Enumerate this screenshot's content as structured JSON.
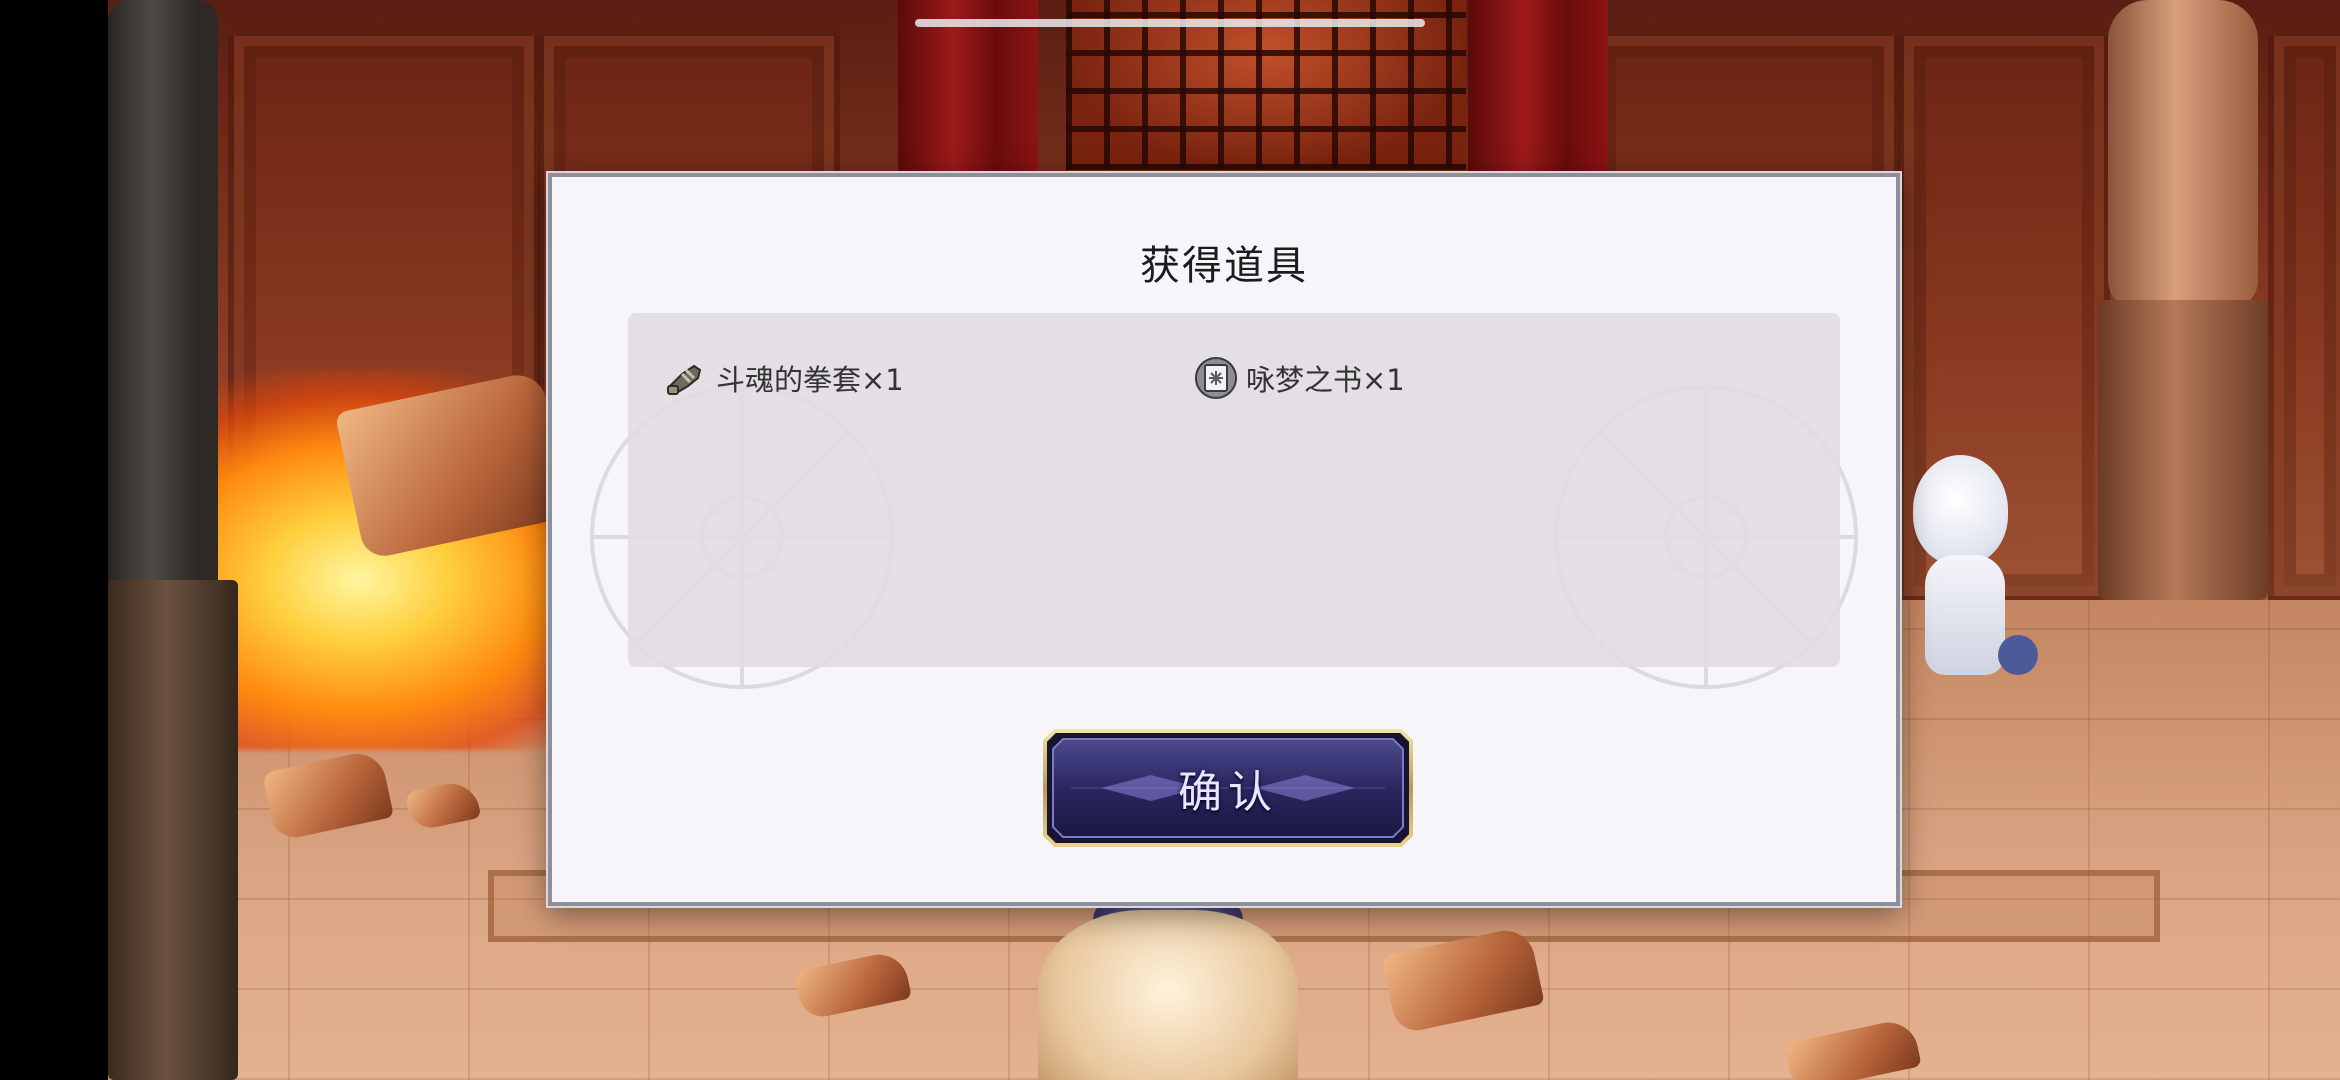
{
  "dialog": {
    "title": "获得道具",
    "items": [
      {
        "name": "斗魂的拳套×1",
        "icon": "gauntlet-icon"
      },
      {
        "name": "咏梦之书×1",
        "icon": "book-icon"
      }
    ],
    "confirm_label": "确认"
  },
  "colors": {
    "dialog_bg": "#f6f5f9",
    "panel_bg": "#e1dce2",
    "button_bg": "#2e2a5e",
    "button_border": "#c9b06a",
    "title_text": "#1c1c1c"
  }
}
